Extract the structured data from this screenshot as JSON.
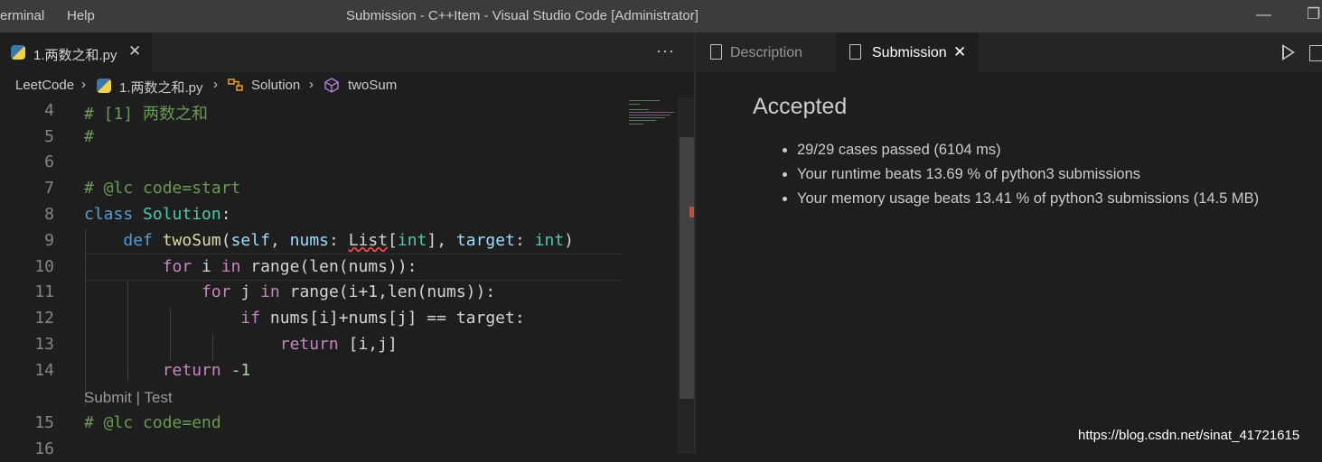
{
  "menu": {
    "terminal": "erminal",
    "help": "Help"
  },
  "window": {
    "title": "Submission - C++Item - Visual Studio Code [Administrator]",
    "minimize": "—",
    "restore": "❐"
  },
  "left_tabs": {
    "file_tab": "1.两数之和.py",
    "close": "✕",
    "more": "···"
  },
  "breadcrumb": {
    "root": "LeetCode",
    "file": "1.两数之和.py",
    "class": "Solution",
    "method": "twoSum",
    "sep": "›"
  },
  "editor": {
    "lines": [
      4,
      5,
      6,
      7,
      8,
      9,
      10,
      11,
      12,
      13,
      14,
      15,
      16
    ],
    "code": {
      "l4": "# [1] 两数之和",
      "l5": "#",
      "l7": "# @lc code=start",
      "l8_kw": "class",
      "l8_cls": "Solution",
      "l8_end": ":",
      "l9_kw": "def",
      "l9_fn": "twoSum",
      "l9_p1": "(",
      "l9_self": "self",
      "l9_p2": ", ",
      "l9_nums": "nums",
      "l9_p3": ": ",
      "l9_list": "List",
      "l9_p4": "[",
      "l9_int": "int",
      "l9_p5": "], ",
      "l9_target": "target",
      "l9_p6": ": ",
      "l9_int2": "int",
      "l9_p7": ")",
      "l10_for": "for",
      "l10_i": " i ",
      "l10_in": "in",
      "l10_rest": " range(len(nums)):",
      "l11_for": "for",
      "l11_j": " j ",
      "l11_in": "in",
      "l11_rest": " range(i+1,len(nums)):",
      "l12_if": "if",
      "l12_rest": " nums[i]+nums[j] == target:",
      "l13_ret": "return",
      "l13_rest": " [i,j]",
      "l14_ret": "return",
      "l14_rest": " -1",
      "l15": "# @lc code=end"
    },
    "codelens": {
      "submit": "Submit",
      "sep": " | ",
      "test": "Test"
    }
  },
  "right_tabs": {
    "description": "Description",
    "submission": "Submission",
    "close": "✕"
  },
  "submission": {
    "status": "Accepted",
    "results": [
      "29/29 cases passed (6104 ms)",
      "Your runtime beats 13.69 % of python3 submissions",
      "Your memory usage beats 13.41 % of python3 submissions (14.5 MB)"
    ]
  },
  "watermark": "https://blog.csdn.net/sinat_41721615"
}
